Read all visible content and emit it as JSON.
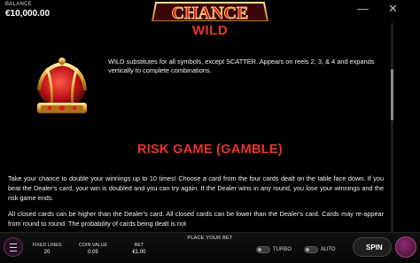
{
  "header": {
    "balance_label": "BALANCE",
    "balance_value": "€10,000.00",
    "logo_text": "CHANCE",
    "minimize_glyph": "—",
    "close_glyph": "✕"
  },
  "paytable": {
    "wild_title": "WILD",
    "wild_description": "WILD substitutes for all symbols, except SCATTER. Appears on reels 2, 3, & 4 and expands vertically to complete combinations.",
    "wild_icon": "crown-icon",
    "risk_title": "RISK GAME (GAMBLE)",
    "risk_paragraph_1": "Take your chance to double your winnings up to 10 times! Choose a card from the four cards dealt on the table face down. If you beat the Dealer's card, your win is doubled and you can try again. If the Dealer wins in any round, you lose your winnings and the risk game ends.",
    "risk_paragraph_2": "All closed cards can be higher than the Dealer's card. All closed cards can be lower than the Dealer's card. Cards may re-appear from round to round. The probability of cards being dealt is not"
  },
  "controls": {
    "fixed_lines_label": "FIXED LINES",
    "fixed_lines_value": "20",
    "coin_value_label": "COIN VALUE",
    "coin_value_value": "0.05",
    "bet_label": "BET",
    "bet_value": "€1.00",
    "place_bet_text": "PLACE YOUR BET",
    "turbo_label": "TURBO",
    "auto_label": "AUTO",
    "spin_label": "SPIN"
  },
  "colors": {
    "title_red": "#e8342d",
    "brand_purple": "#8a2a6e"
  }
}
